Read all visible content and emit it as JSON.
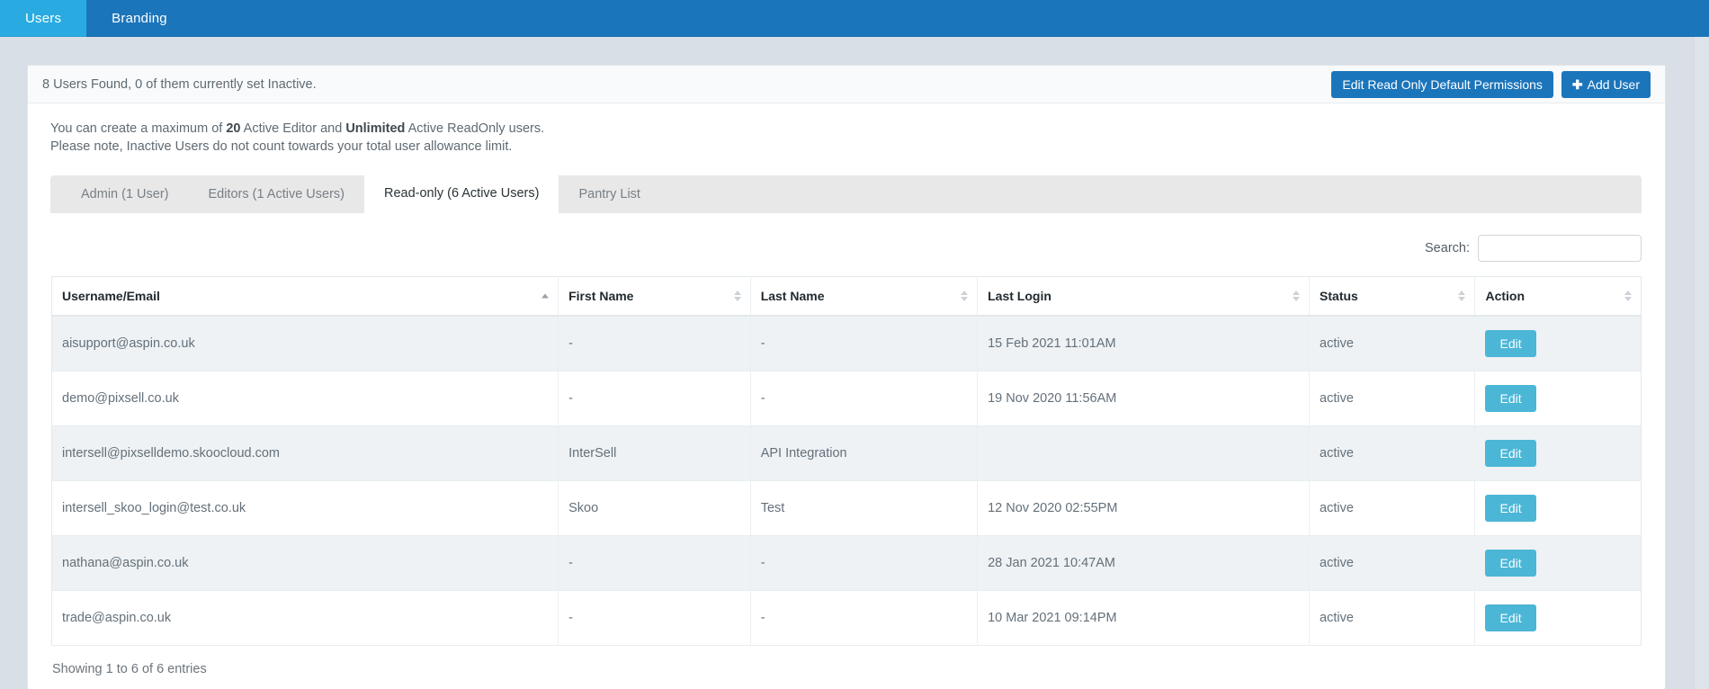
{
  "topnav": {
    "tabs": [
      {
        "label": "Users",
        "active": true
      },
      {
        "label": "Branding",
        "active": false
      }
    ]
  },
  "panel": {
    "heading_text": "8 Users Found, 0 of them currently set Inactive.",
    "edit_permissions_label": "Edit Read Only Default Permissions",
    "add_user_label": "Add User",
    "add_user_icon": "plus-icon",
    "notice_line1_pre": "You can create a maximum of ",
    "notice_line1_bold1": "20",
    "notice_line1_mid": " Active Editor and ",
    "notice_line1_bold2": "Unlimited",
    "notice_line1_post": " Active ReadOnly users.",
    "notice_line2": "Please note, Inactive Users do not count towards your total user allowance limit."
  },
  "tabs": [
    {
      "label": "Admin (1 User)",
      "active": false
    },
    {
      "label": "Editors (1 Active Users)",
      "active": false
    },
    {
      "label": "Read-only (6 Active Users)",
      "active": true
    },
    {
      "label": "Pantry List",
      "active": false
    }
  ],
  "search": {
    "label": "Search:",
    "value": "",
    "placeholder": ""
  },
  "table": {
    "columns": [
      {
        "label": "Username/Email",
        "sort": "asc"
      },
      {
        "label": "First Name",
        "sort": "none"
      },
      {
        "label": "Last Name",
        "sort": "none"
      },
      {
        "label": "Last Login",
        "sort": "none"
      },
      {
        "label": "Status",
        "sort": "none"
      },
      {
        "label": "Action",
        "sort": "none"
      }
    ],
    "rows": [
      {
        "username": "aisupport@aspin.co.uk",
        "first_name": "-",
        "last_name": "-",
        "last_login": "15 Feb 2021 11:01AM",
        "status": "active",
        "action_label": "Edit"
      },
      {
        "username": "demo@pixsell.co.uk",
        "first_name": "-",
        "last_name": "-",
        "last_login": "19 Nov 2020 11:56AM",
        "status": "active",
        "action_label": "Edit"
      },
      {
        "username": "intersell@pixselldemo.skoocloud.com",
        "first_name": "InterSell",
        "last_name": "API Integration",
        "last_login": "",
        "status": "active",
        "action_label": "Edit"
      },
      {
        "username": "intersell_skoo_login@test.co.uk",
        "first_name": "Skoo",
        "last_name": "Test",
        "last_login": "12 Nov 2020 02:55PM",
        "status": "active",
        "action_label": "Edit"
      },
      {
        "username": "nathana@aspin.co.uk",
        "first_name": "-",
        "last_name": "-",
        "last_login": "28 Jan 2021 10:47AM",
        "status": "active",
        "action_label": "Edit"
      },
      {
        "username": "trade@aspin.co.uk",
        "first_name": "-",
        "last_name": "-",
        "last_login": "10 Mar 2021 09:14PM",
        "status": "active",
        "action_label": "Edit"
      }
    ],
    "info": "Showing 1 to 6 of 6 entries"
  },
  "colors": {
    "nav_bar": "#1b75bb",
    "nav_active_tab": "#29abe2",
    "primary_button": "#1b75bb",
    "edit_button": "#4cb6d6",
    "page_background": "#d8dfe6",
    "row_stripe": "#eef2f5"
  }
}
